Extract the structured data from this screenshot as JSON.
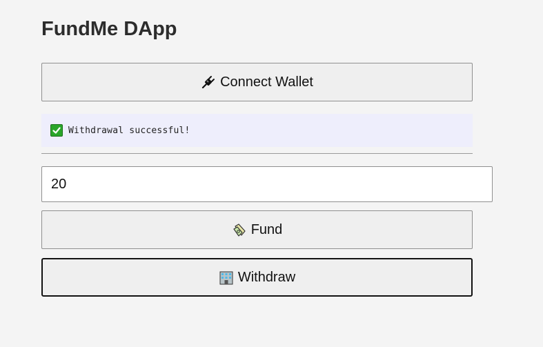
{
  "app": {
    "title": "FundMe DApp"
  },
  "wallet": {
    "connect_label": "Connect Wallet",
    "icon": "plug-icon"
  },
  "status": {
    "message": "Withdrawal successful!",
    "icon": "check-mark-icon",
    "type": "success"
  },
  "fund_form": {
    "amount_value": "20",
    "fund_label": "Fund",
    "fund_icon": "money-bag-icon",
    "withdraw_label": "Withdraw",
    "withdraw_icon": "bank-building-icon"
  },
  "colors": {
    "background": "#f4f4f4",
    "status_background": "#eeeefc",
    "success_green": "#2aa52a",
    "button_background": "#efefef"
  }
}
